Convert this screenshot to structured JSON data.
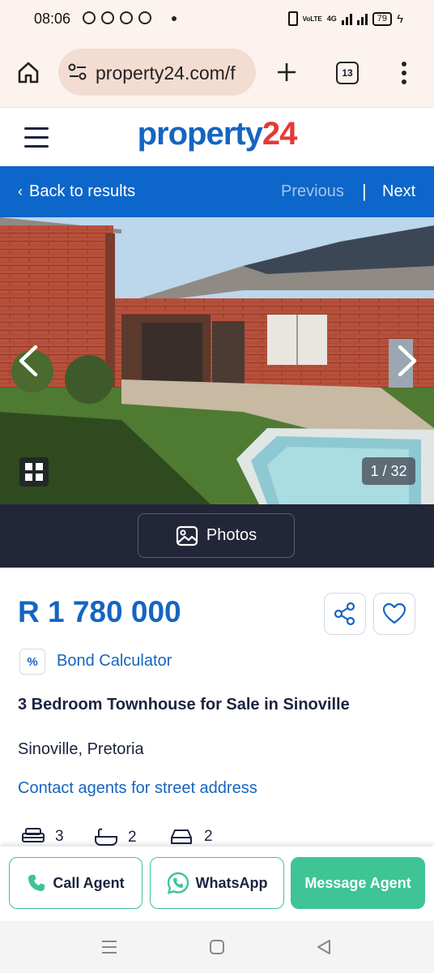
{
  "status_bar": {
    "time": "08:06",
    "network_label": "VoLTE",
    "network_type": "4G",
    "battery": "79"
  },
  "browser": {
    "url": "property24.com/f",
    "tab_count": "13"
  },
  "site": {
    "logo_main": "property",
    "logo_accent": "24",
    "brand_blue": "#1565c0",
    "brand_red": "#e53935"
  },
  "nav": {
    "back_label": "Back to results",
    "previous_label": "Previous",
    "separator": "|",
    "next_label": "Next"
  },
  "gallery": {
    "counter": "1 / 32",
    "photos_button": "Photos"
  },
  "listing": {
    "price": "R 1 780 000",
    "bond_icon": "%",
    "bond_label": "Bond Calculator",
    "title": "3 Bedroom Townhouse for Sale in Sinoville",
    "location": "Sinoville, Pretoria",
    "contact_link": "Contact agents for street address",
    "features": {
      "bedrooms": "3",
      "bathrooms": "2",
      "garages": "2"
    }
  },
  "actions": {
    "call": "Call Agent",
    "whatsapp": "WhatsApp",
    "message": "Message Agent",
    "accent_green": "#3ec495"
  }
}
